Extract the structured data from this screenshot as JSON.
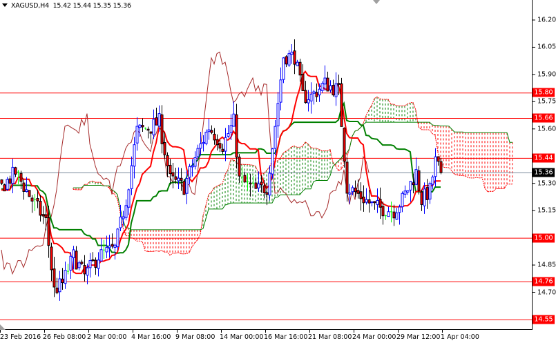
{
  "header": {
    "symbol": "XAGUSD,H4",
    "open": "15.42",
    "high": "15.44",
    "low": "15.35",
    "close": "15.36"
  },
  "price_axis": {
    "ticks": [
      "16.20",
      "16.05",
      "15.90",
      "15.75",
      "15.60",
      "15.30",
      "15.15",
      "14.85",
      "14.70"
    ],
    "tick_values": [
      16.2,
      16.05,
      15.9,
      15.75,
      15.6,
      15.3,
      15.15,
      14.85,
      14.7
    ]
  },
  "levels": [
    {
      "label": "15.80",
      "value": 15.8
    },
    {
      "label": "15.66",
      "value": 15.66
    },
    {
      "label": "15.44",
      "value": 15.44
    },
    {
      "label": "15.00",
      "value": 15.0
    },
    {
      "label": "14.76",
      "value": 14.76
    },
    {
      "label": "14.55",
      "value": 14.55
    }
  ],
  "current_price": {
    "label": "15.36",
    "value": 15.36
  },
  "time_axis": [
    "23 Feb 2016",
    "26 Feb 08:00",
    "2 Mar 00:00",
    "4 Mar 16:00",
    "9 Mar 08:00",
    "14 Mar 00:00",
    "16 Mar 16:00",
    "21 Mar 08:00",
    "24 Mar 00:00",
    "29 Mar 12:00",
    "1 Apr 04:00"
  ],
  "colors": {
    "level": "#ff0000",
    "bull": "#0000ff",
    "bear_body": "#ff0000",
    "doji": "#00ff00",
    "tenkan": "#ff0000",
    "kijun": "#008000",
    "chikou": "#a52a2a",
    "cloud_bear": "#ff0000",
    "cloud_bull": "#008000",
    "current": "#778899"
  },
  "chart_data": {
    "type": "candlestick",
    "title": "XAGUSD,H4",
    "ylim": [
      14.5,
      16.28
    ],
    "bars": 160,
    "indicators": [
      "Ichimoku Kinko Hyo (9,26,52)"
    ],
    "approx_close_path": [
      [
        0,
        15.28
      ],
      [
        5,
        15.36
      ],
      [
        11,
        15.21
      ],
      [
        16,
        15.09
      ],
      [
        19,
        14.71
      ],
      [
        22,
        14.75
      ],
      [
        26,
        14.9
      ],
      [
        30,
        14.79
      ],
      [
        35,
        14.9
      ],
      [
        41,
        14.94
      ],
      [
        45,
        15.21
      ],
      [
        49,
        15.59
      ],
      [
        54,
        15.61
      ],
      [
        57,
        15.64
      ],
      [
        61,
        15.32
      ],
      [
        66,
        15.28
      ],
      [
        70,
        15.44
      ],
      [
        75,
        15.61
      ],
      [
        80,
        15.51
      ],
      [
        84,
        15.64
      ],
      [
        86,
        15.32
      ],
      [
        92,
        15.26
      ],
      [
        96,
        15.28
      ],
      [
        99,
        15.62
      ],
      [
        102,
        16.0
      ],
      [
        106,
        16.0
      ],
      [
        109,
        15.78
      ],
      [
        112,
        15.78
      ],
      [
        117,
        15.85
      ],
      [
        122,
        15.81
      ],
      [
        125,
        15.28
      ],
      [
        129,
        15.24
      ],
      [
        135,
        15.17
      ],
      [
        142,
        15.15
      ],
      [
        145,
        15.21
      ],
      [
        150,
        15.36
      ],
      [
        152,
        15.21
      ],
      [
        155,
        15.26
      ],
      [
        157,
        15.42
      ],
      [
        159,
        15.36
      ]
    ],
    "last_bar": {
      "open": 15.42,
      "high": 15.44,
      "low": 15.35,
      "close": 15.36
    }
  }
}
